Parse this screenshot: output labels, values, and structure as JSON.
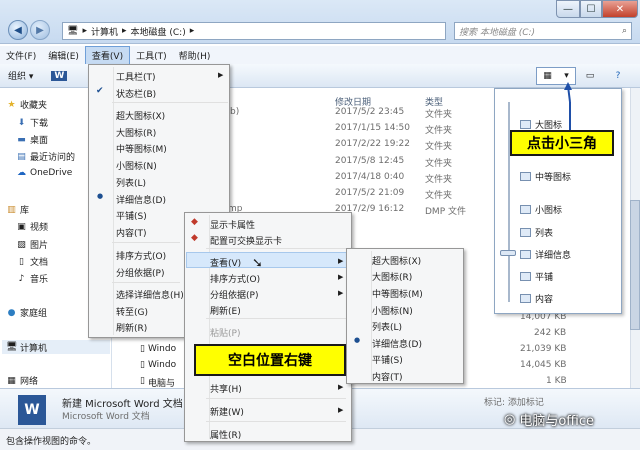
{
  "window": {
    "back_icon": "back-arrow-icon",
    "forward_icon": "forward-arrow-icon",
    "address": [
      "计算机",
      "本地磁盘 (C:)"
    ],
    "search_placeholder": "搜索 本地磁盘 (C:)",
    "min": "—",
    "max": "☐",
    "close": "✕"
  },
  "menubar": {
    "items": [
      {
        "label": "文件(F)"
      },
      {
        "label": "编辑(E)"
      },
      {
        "label": "查看(V)",
        "active": true
      },
      {
        "label": "工具(T)"
      },
      {
        "label": "帮助(H)"
      }
    ]
  },
  "toolbar": {
    "organize": "组织 ▾",
    "word_icon": "W"
  },
  "nav": {
    "favorites": "收藏夹",
    "downloads": "下载",
    "desktop": "桌面",
    "recent": "最近访问的",
    "onedrive": "OneDrive",
    "library": "库",
    "video": "视频",
    "pictures": "图片",
    "documents": "文档",
    "music": "音乐",
    "homegroup": "家庭组",
    "computer": "计算机",
    "network": "网络"
  },
  "columns": {
    "modified": "修改日期",
    "type": "类型",
    "size": "大小"
  },
  "rows": [
    {
      "name": "b)",
      "date": "2017/5/2 23:45",
      "type": "文件夹",
      "size": ""
    },
    {
      "name": "",
      "date": "2017/1/15 14:50",
      "type": "文件夹",
      "size": ""
    },
    {
      "name": "",
      "date": "2017/2/22 19:22",
      "type": "文件夹",
      "size": ""
    },
    {
      "name": "",
      "date": "2017/5/8 12:45",
      "type": "文件夹",
      "size": ""
    },
    {
      "name": "",
      "date": "2017/4/18 0:40",
      "type": "文件夹",
      "size": ""
    },
    {
      "name": "",
      "date": "2017/5/2 21:09",
      "type": "文件夹",
      "size": ""
    },
    {
      "name": "mp",
      "date": "2017/2/9 16:12",
      "type": "DMP 文件",
      "size": ""
    }
  ],
  "sizes": [
    "14,007 KB",
    "242 KB",
    "21,039 KB",
    "14,045 KB",
    "1 KB"
  ],
  "files": [
    "Windo",
    "Windo",
    "电脑与"
  ],
  "view_menu": {
    "items": [
      {
        "label": "工具栏(T)",
        "arrow": "▶"
      },
      {
        "label": "状态栏(B)",
        "check": "✔"
      },
      {
        "label": "超大图标(X)"
      },
      {
        "label": "大图标(R)"
      },
      {
        "label": "中等图标(M)"
      },
      {
        "label": "小图标(N)"
      },
      {
        "label": "列表(L)"
      },
      {
        "label": "详细信息(D)",
        "dot": "●"
      },
      {
        "label": "平铺(S)"
      },
      {
        "label": "内容(T)"
      },
      {
        "label": "排序方式(O)",
        "arrow": "▶"
      },
      {
        "label": "分组依据(P)",
        "arrow": "▶"
      },
      {
        "label": "选择详细信息(H)"
      },
      {
        "label": "转至(G)",
        "arrow": "▶"
      },
      {
        "label": "刷新(R)"
      }
    ]
  },
  "context_menu": {
    "items": [
      {
        "label": "显示卡属性"
      },
      {
        "label": "配置可交换显示卡"
      },
      {
        "label": "查看(V)",
        "arrow": "▶"
      },
      {
        "label": "排序方式(O)",
        "arrow": "▶"
      },
      {
        "label": "分组依据(P)",
        "arrow": "▶"
      },
      {
        "label": "刷新(E)"
      },
      {
        "label": "粘贴(P)"
      },
      {
        "label": "共享(H)",
        "arrow": "▶"
      },
      {
        "label": "新建(W)",
        "arrow": "▶"
      },
      {
        "label": "属性(R)"
      }
    ]
  },
  "sub_menu": {
    "items": [
      {
        "label": "超大图标(X)"
      },
      {
        "label": "大图标(R)"
      },
      {
        "label": "中等图标(M)"
      },
      {
        "label": "小图标(N)"
      },
      {
        "label": "列表(L)"
      },
      {
        "label": "详细信息(D)",
        "dot": "●"
      },
      {
        "label": "平铺(S)"
      },
      {
        "label": "内容(T)"
      }
    ]
  },
  "view_panel": {
    "items": [
      "超大图标",
      "中等图标",
      "小图标",
      "列表",
      "详细信息",
      "平铺",
      "内容"
    ],
    "partial_top": "大图标"
  },
  "details": {
    "title": "新建 Microsoft Word 文档",
    "subtitle": "Microsoft Word 文档",
    "tag_label": "标记: 添加标记"
  },
  "status": "包含操作视图的命令。",
  "callouts": {
    "triangle": "点击小三角",
    "rightclick": "空白位置右键"
  },
  "watermark": "电脑与office",
  "colors": {
    "callout": "#ffff00",
    "border_blue": "#1f4fa8"
  }
}
